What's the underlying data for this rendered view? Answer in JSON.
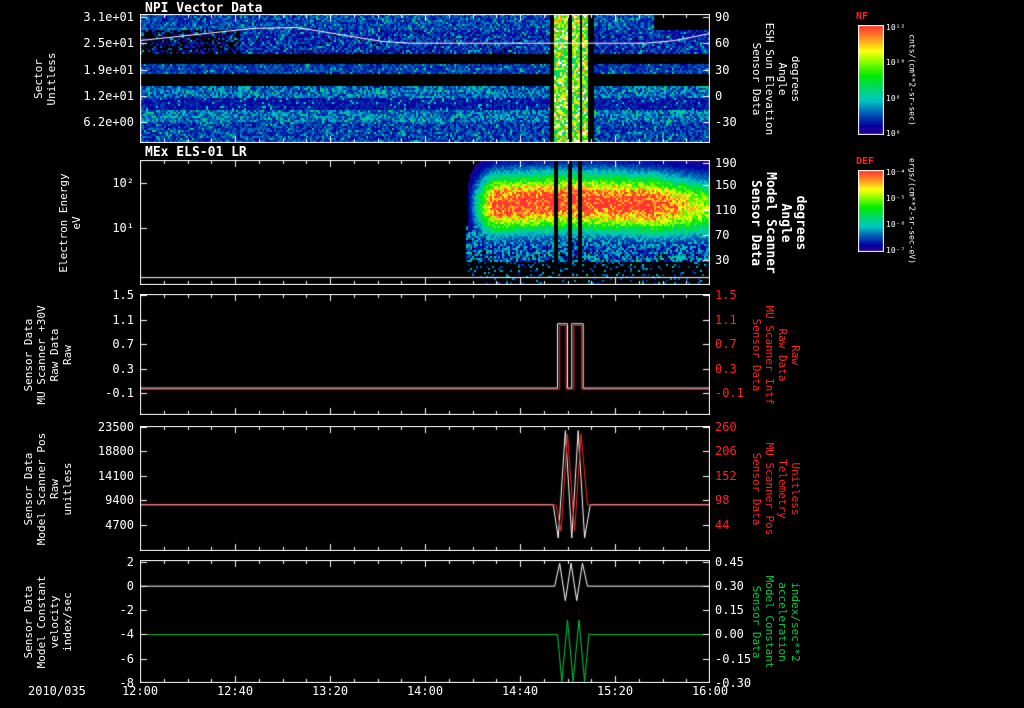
{
  "x_axis": {
    "date_label": "2010/035",
    "tick_labels": [
      "12:00",
      "12:40",
      "13:20",
      "14:00",
      "14:40",
      "15:20",
      "16:00"
    ],
    "range_hours": [
      0,
      4
    ]
  },
  "colors": {
    "red": "#ff2222",
    "green": "#00cc44",
    "white": "#ffffff",
    "background": "#000000"
  },
  "colorbars": [
    {
      "title": "NF",
      "tick_labels": [
        "10¹²",
        "10¹⁰",
        "10⁸",
        "10⁶"
      ],
      "units": "cnts/(cm**2-sr-sec)"
    },
    {
      "title": "DEF",
      "tick_labels": [
        "10⁻⁴",
        "10⁻⁵",
        "10⁻⁶",
        "10⁻⁷"
      ],
      "units": "ergs/(cm**2-sr-sec-eV)"
    }
  ],
  "chart_data": [
    {
      "id": "npi-vector-data",
      "type": "heatmap",
      "title": "NPI Vector Data",
      "left_label_lines": [
        "Sector",
        "Unitless"
      ],
      "right_label_lines": [
        "Sensor Data",
        "ESH Sun Elevation",
        "Angle",
        "degrees"
      ],
      "left_ticks": [
        {
          "label": "3.1e+01",
          "frac": 0.023
        },
        {
          "label": "2.5e+01",
          "frac": 0.225
        },
        {
          "label": "1.9e+01",
          "frac": 0.434
        },
        {
          "label": "1.2e+01",
          "frac": 0.636
        },
        {
          "label": "6.2e+00",
          "frac": 0.837
        }
      ],
      "right_ticks": [
        {
          "label": "90",
          "frac": 0.023
        },
        {
          "label": "60",
          "frac": 0.225
        },
        {
          "label": "30",
          "frac": 0.434
        },
        {
          "label": "0",
          "frac": 0.636
        },
        {
          "label": "-30",
          "frac": 0.837
        }
      ],
      "right_scale": {
        "v1": 90,
        "f1": 0.023,
        "v2": -30,
        "f2": 0.837
      },
      "series": [
        {
          "name": "esh-sun-elevation-angle",
          "color": "#ffffff",
          "axis": "right",
          "points": [
            [
              0,
              63
            ],
            [
              0.4,
              70
            ],
            [
              0.8,
              77
            ],
            [
              1.1,
              78
            ],
            [
              1.4,
              70
            ],
            [
              1.7,
              62
            ],
            [
              1.9,
              60
            ],
            [
              3.55,
              60
            ],
            [
              3.75,
              63
            ],
            [
              4,
              71
            ]
          ]
        }
      ],
      "spectrogram": {
        "kind": "bands",
        "value_units": "cnts/(cm**2-sr-sec)",
        "bands": [
          [
            0,
            0.115,
            0.2,
            0.1
          ],
          [
            0.115,
            0.3,
            0.16,
            0.12
          ],
          [
            0.3,
            0.375,
            0,
            0
          ],
          [
            0.375,
            0.465,
            0.19,
            0.08
          ],
          [
            0.465,
            0.55,
            0,
            0
          ],
          [
            0.55,
            0.645,
            0.24,
            0.12
          ],
          [
            0.645,
            0.73,
            0.14,
            0.08
          ],
          [
            0.73,
            0.825,
            0.25,
            0.12
          ],
          [
            0.825,
            1,
            0.19,
            0.1
          ]
        ],
        "left_dark_band": 1,
        "right_black_band": 0,
        "event": {
          "t0": 2.9,
          "t1": 3.13,
          "gaps": [
            [
              2.87,
              2.9
            ],
            [
              2.99,
              3.02
            ],
            [
              3.08,
              3.1
            ],
            [
              3.14,
              3.18
            ]
          ]
        }
      }
    },
    {
      "id": "mex-els-01-lr",
      "type": "heatmap",
      "title": "MEx ELS-01 LR",
      "left_label_lines": [
        "Electron Energy",
        "eV"
      ],
      "right_label_lines": [
        "Sensor Data",
        "Model Scanner",
        "Angle",
        "degrees"
      ],
      "right_label_bold": true,
      "left_ticks": [
        {
          "label": "10²",
          "frac": 0.184
        },
        {
          "label": "10¹",
          "frac": 0.544
        }
      ],
      "right_ticks": [
        {
          "label": "190",
          "frac": 0.024
        },
        {
          "label": "150",
          "frac": 0.2
        },
        {
          "label": "110",
          "frac": 0.4
        },
        {
          "label": "70",
          "frac": 0.6
        },
        {
          "label": "30",
          "frac": 0.8
        }
      ],
      "right_scale": {
        "v1": 190,
        "f1": 0.024,
        "v2": 30,
        "f2": 0.8
      },
      "series": [
        {
          "name": "scanner-angle-overlay",
          "color": "#ffffff",
          "axis": "right",
          "points": [
            [
              0,
              1
            ],
            [
              4,
              1
            ]
          ]
        }
      ],
      "spectrogram": {
        "kind": "blob",
        "value_units": "ergs/(cm**2-sr-sec-eV)",
        "t_start": 2.28,
        "ramp": 0.2,
        "taper_start": 3.6,
        "logE_top": 2.5,
        "logE_bottom": -0.27,
        "core_logE": 1.5,
        "core_sigma": 0.65,
        "gaps": [
          [
            2.9,
            2.93
          ],
          [
            2.99,
            3.03
          ],
          [
            3.07,
            3.1
          ]
        ]
      }
    },
    {
      "id": "mu-scanner-raw",
      "type": "line",
      "title": "",
      "left_label_lines": [
        "Sensor Data",
        "MU Scanner +30V",
        "Raw Data",
        "Raw"
      ],
      "right_label_lines": [
        "Sensor Data",
        "MU Scanner Intf",
        "Raw Data",
        "Raw"
      ],
      "right_label_color": "#ff2222",
      "right_tick_color": "#ff2222",
      "left_ticks": [
        {
          "label": "1.5",
          "frac": 0.008
        },
        {
          "label": "1.1",
          "frac": 0.215
        },
        {
          "label": "0.7",
          "frac": 0.413
        },
        {
          "label": "0.3",
          "frac": 0.62
        },
        {
          "label": "-0.1",
          "frac": 0.818
        }
      ],
      "right_ticks": [
        {
          "label": "1.5",
          "frac": 0.008
        },
        {
          "label": "1.1",
          "frac": 0.215
        },
        {
          "label": "0.7",
          "frac": 0.413
        },
        {
          "label": "0.3",
          "frac": 0.62
        },
        {
          "label": "-0.1",
          "frac": 0.818
        }
      ],
      "left_scale": {
        "v1": 1.5,
        "f1": 0.008,
        "v2": -0.1,
        "f2": 0.818
      },
      "right_scale": {
        "v1": 1.5,
        "f1": 0.008,
        "v2": -0.1,
        "f2": 0.818
      },
      "series": [
        {
          "name": "mu-scanner-p30v-raw",
          "color": "#ffffff",
          "axis": "left",
          "points": [
            [
              0,
              -0.02
            ],
            [
              2.93,
              -0.02
            ],
            [
              2.93,
              1.03
            ],
            [
              3.0,
              1.03
            ],
            [
              3.0,
              -0.02
            ],
            [
              3.03,
              -0.02
            ],
            [
              3.03,
              1.03
            ],
            [
              3.11,
              1.03
            ],
            [
              3.11,
              -0.02
            ],
            [
              4,
              -0.02
            ]
          ]
        },
        {
          "name": "mu-scanner-intf-raw",
          "color": "#ff2222",
          "axis": "right",
          "points": [
            [
              0,
              -0.04
            ],
            [
              2.945,
              -0.04
            ],
            [
              2.945,
              1.0
            ],
            [
              2.99,
              1.0
            ],
            [
              2.99,
              -0.04
            ],
            [
              3.045,
              -0.04
            ],
            [
              3.045,
              1.0
            ],
            [
              3.1,
              1.0
            ],
            [
              3.1,
              -0.04
            ],
            [
              4,
              -0.04
            ]
          ]
        }
      ]
    },
    {
      "id": "model-scanner-pos",
      "type": "line",
      "title": "",
      "left_label_lines": [
        "Sensor Data",
        "Model Scanner Pos",
        "Raw",
        "unitless"
      ],
      "right_label_lines": [
        "Sensor Data",
        "MU Scanner Pos",
        "Telemetry",
        "Unitless"
      ],
      "right_label_color": "#ff2222",
      "right_tick_color": "#ff2222",
      "left_ticks": [
        {
          "label": "23500",
          "frac": 0.008
        },
        {
          "label": "18800",
          "frac": 0.2
        },
        {
          "label": "14100",
          "frac": 0.4
        },
        {
          "label": "9400",
          "frac": 0.592
        },
        {
          "label": "4700",
          "frac": 0.792
        }
      ],
      "right_ticks": [
        {
          "label": "260",
          "frac": 0.008
        },
        {
          "label": "206",
          "frac": 0.2
        },
        {
          "label": "152",
          "frac": 0.4
        },
        {
          "label": "98",
          "frac": 0.592
        },
        {
          "label": "44",
          "frac": 0.792
        }
      ],
      "left_scale": {
        "v1": 23500,
        "f1": 0.008,
        "v2": 4700,
        "f2": 0.792
      },
      "right_scale": {
        "v1": 260,
        "f1": 0.008,
        "v2": 44,
        "f2": 0.792
      },
      "series": [
        {
          "name": "model-scanner-pos-raw",
          "color": "#ffffff",
          "axis": "left",
          "points": [
            [
              0,
              8600
            ],
            [
              2.9,
              8600
            ],
            [
              2.935,
              2200
            ],
            [
              2.985,
              22800
            ],
            [
              3.03,
              2200
            ],
            [
              3.075,
              22800
            ],
            [
              3.12,
              2200
            ],
            [
              3.16,
              8600
            ],
            [
              4,
              8600
            ]
          ]
        },
        {
          "name": "mu-scanner-pos-telemetry",
          "color": "#ff2222",
          "axis": "right",
          "points": [
            [
              0,
              88
            ],
            [
              2.92,
              88
            ],
            [
              2.955,
              30
            ],
            [
              3.0,
              245
            ],
            [
              3.05,
              30
            ],
            [
              3.095,
              245
            ],
            [
              3.14,
              88
            ],
            [
              4,
              88
            ]
          ]
        }
      ]
    },
    {
      "id": "model-constant",
      "type": "line",
      "title": "",
      "left_label_lines": [
        "Sensor Data",
        "Model Constant",
        "velocity",
        "index/sec"
      ],
      "right_label_lines": [
        "Sensor Data",
        "Model Constant",
        "acceleration",
        "index/sec**2"
      ],
      "right_label_color": "#00cc44",
      "left_ticks": [
        {
          "label": "2",
          "frac": 0.016
        },
        {
          "label": "0",
          "frac": 0.211
        },
        {
          "label": "-2",
          "frac": 0.407
        },
        {
          "label": "-4",
          "frac": 0.602
        },
        {
          "label": "-6",
          "frac": 0.805
        },
        {
          "label": "-8",
          "frac": 1.0
        }
      ],
      "right_ticks": [
        {
          "label": "0.45",
          "frac": 0.016
        },
        {
          "label": "0.30",
          "frac": 0.211
        },
        {
          "label": "0.15",
          "frac": 0.407
        },
        {
          "label": "0.00",
          "frac": 0.602
        },
        {
          "label": "-0.15",
          "frac": 0.805
        },
        {
          "label": "-0.30",
          "frac": 1.0
        }
      ],
      "left_scale": {
        "v1": 2,
        "f1": 0.016,
        "v2": -8,
        "f2": 1.0
      },
      "right_scale": {
        "v1": 0.45,
        "f1": 0.016,
        "v2": -0.3,
        "f2": 1.0
      },
      "series": [
        {
          "name": "model-constant-velocity",
          "color": "#ffffff",
          "axis": "left",
          "points": [
            [
              0,
              0
            ],
            [
              2.91,
              0
            ],
            [
              2.945,
              1.9
            ],
            [
              2.985,
              -1.2
            ],
            [
              3.025,
              1.9
            ],
            [
              3.065,
              -1.2
            ],
            [
              3.105,
              1.9
            ],
            [
              3.14,
              0
            ],
            [
              4,
              0
            ]
          ]
        },
        {
          "name": "model-constant-acceleration",
          "color": "#00cc44",
          "axis": "right",
          "points": [
            [
              0,
              0
            ],
            [
              2.93,
              0
            ],
            [
              2.96,
              -0.29
            ],
            [
              3.0,
              0.09
            ],
            [
              3.04,
              -0.29
            ],
            [
              3.08,
              0.09
            ],
            [
              3.12,
              -0.29
            ],
            [
              3.15,
              0
            ],
            [
              4,
              0
            ]
          ]
        }
      ]
    }
  ]
}
